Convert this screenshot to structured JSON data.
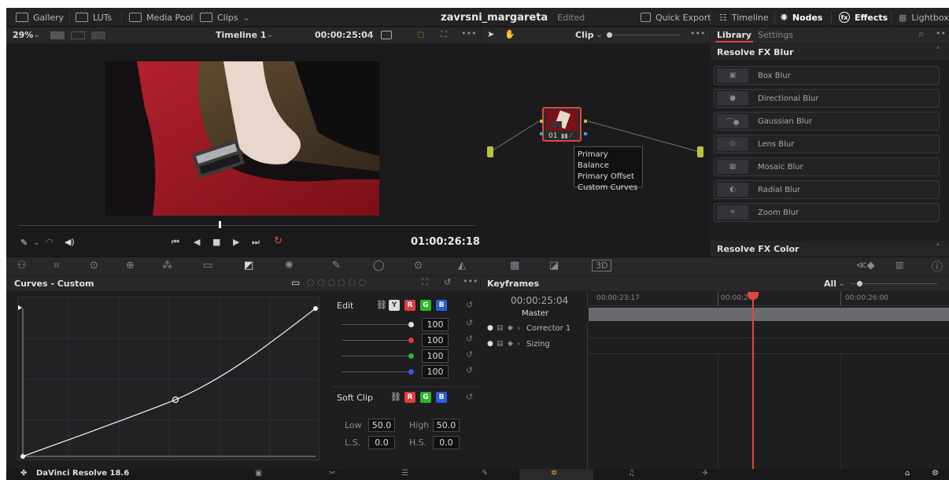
{
  "topbar": {
    "gallery": "Gallery",
    "luts": "LUTs",
    "media_pool": "Media Pool",
    "clips": "Clips",
    "project": "zavrsni_margareta",
    "edited": "Edited",
    "quick_export": "Quick Export",
    "timeline": "Timeline",
    "nodes": "Nodes",
    "effects": "Effects",
    "lightbox": "Lightbox"
  },
  "viewer_bar": {
    "zoom": "29%",
    "timeline_name": "Timeline 1",
    "timecode": "00:00:25:04",
    "clip_mode": "Clip"
  },
  "viewer": {
    "timecode": "01:00:26:18"
  },
  "node": {
    "label": "01",
    "tooltip": [
      "Primary Balance",
      "Primary Offset",
      "Custom Curves"
    ]
  },
  "library": {
    "tab_library": "Library",
    "tab_settings": "Settings",
    "section_blur": "Resolve FX Blur",
    "items": [
      "Box Blur",
      "Directional Blur",
      "Gaussian Blur",
      "Lens Blur",
      "Mosaic Blur",
      "Radial Blur",
      "Zoom Blur"
    ],
    "section_color": "Resolve FX Color"
  },
  "curves": {
    "title": "Curves - Custom",
    "edit_label": "Edit",
    "intensity": [
      "100",
      "100",
      "100",
      "100"
    ],
    "soft_clip_label": "Soft Clip",
    "low_label": "Low",
    "low": "50.0",
    "high_label": "High",
    "high": "50.0",
    "ls_label": "L.S.",
    "ls": "0.0",
    "hs_label": "H.S.",
    "hs": "0.0",
    "chips": {
      "y": "Y",
      "r": "R",
      "g": "G",
      "b": "B"
    }
  },
  "keyframes": {
    "title": "Keyframes",
    "filter": "All",
    "timecode": "00:00:25:04",
    "ruler": [
      "00:00:23:17",
      "00:00:24:",
      "00:00:26:00"
    ],
    "master": "Master",
    "tracks": [
      "Corrector 1",
      "Sizing"
    ]
  },
  "footer": {
    "app_name": "DaVinci Resolve 18.6"
  },
  "colors": {
    "accent_red": "#e5463a",
    "background": "#1e1e20",
    "panel": "#28282b",
    "curve_point": "#ffffff"
  }
}
